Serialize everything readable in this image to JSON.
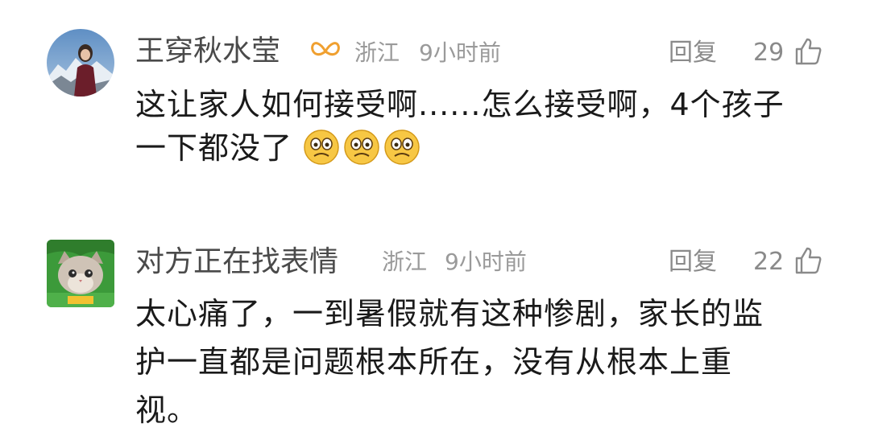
{
  "comments": [
    {
      "username": "王穿秋水莹",
      "location": "浙江",
      "time": "9小时前",
      "reply_label": "回复",
      "likes": "29",
      "body_lines": [
        "这让家人如何接受啊......怎么接受啊，4个孩子",
        "一下都没了"
      ],
      "emojis": [
        "worried-face-icon",
        "worried-face-icon",
        "worried-face-icon"
      ],
      "badge": "ribbon-badge-icon",
      "avatar": "mountain-selfie-avatar"
    },
    {
      "username": "对方正在找表情",
      "location": "浙江",
      "time": "9小时前",
      "reply_label": "回复",
      "likes": "22",
      "body_lines": [
        "太心痛了，一到暑假就有这种惨剧，家长的监",
        "护一直都是问题根本所在，没有从根本上重",
        "视。"
      ],
      "avatar": "cat-avatar"
    }
  ],
  "colors": {
    "username": "#4a4a4a",
    "meta": "#9a9a9a",
    "body": "#1a1a1a",
    "badge": "#f0a030",
    "emoji_face": "#f7c744"
  }
}
